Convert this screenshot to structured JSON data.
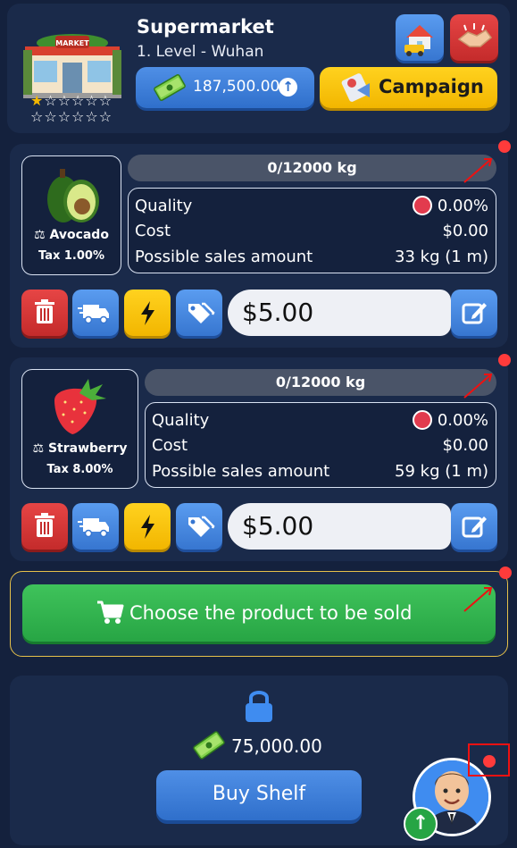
{
  "header": {
    "store_name": "Supermarket",
    "store_level": "1. Level - Wuhan",
    "star_rating": 1,
    "star_total": 12,
    "money": "187,500.00",
    "campaign_label": "Campaign"
  },
  "products": [
    {
      "name": "Avocado",
      "tax": "Tax 1.00%",
      "capacity": "0/12000 kg",
      "quality_label": "Quality",
      "quality_value": "0.00%",
      "cost_label": "Cost",
      "cost_value": "$0.00",
      "sales_label": "Possible sales amount",
      "sales_value": "33 kg (1 m)",
      "price": "$5.00"
    },
    {
      "name": "Strawberry",
      "tax": "Tax 8.00%",
      "capacity": "0/12000 kg",
      "quality_label": "Quality",
      "quality_value": "0.00%",
      "cost_label": "Cost",
      "cost_value": "$0.00",
      "sales_label": "Possible sales amount",
      "sales_value": "59 kg (1 m)",
      "price": "$5.00"
    }
  ],
  "choose_product_label": "Choose the product to be sold",
  "locked_shelf": {
    "price": "75,000.00",
    "buy_label": "Buy Shelf"
  },
  "colors": {
    "background": "#14213d",
    "panel": "#1a2a4a",
    "blue_button": "#3776d0",
    "yellow_button": "#f2b600",
    "red_button": "#c42b2b",
    "green_button": "#27a544",
    "notification": "#ff3b3b"
  }
}
